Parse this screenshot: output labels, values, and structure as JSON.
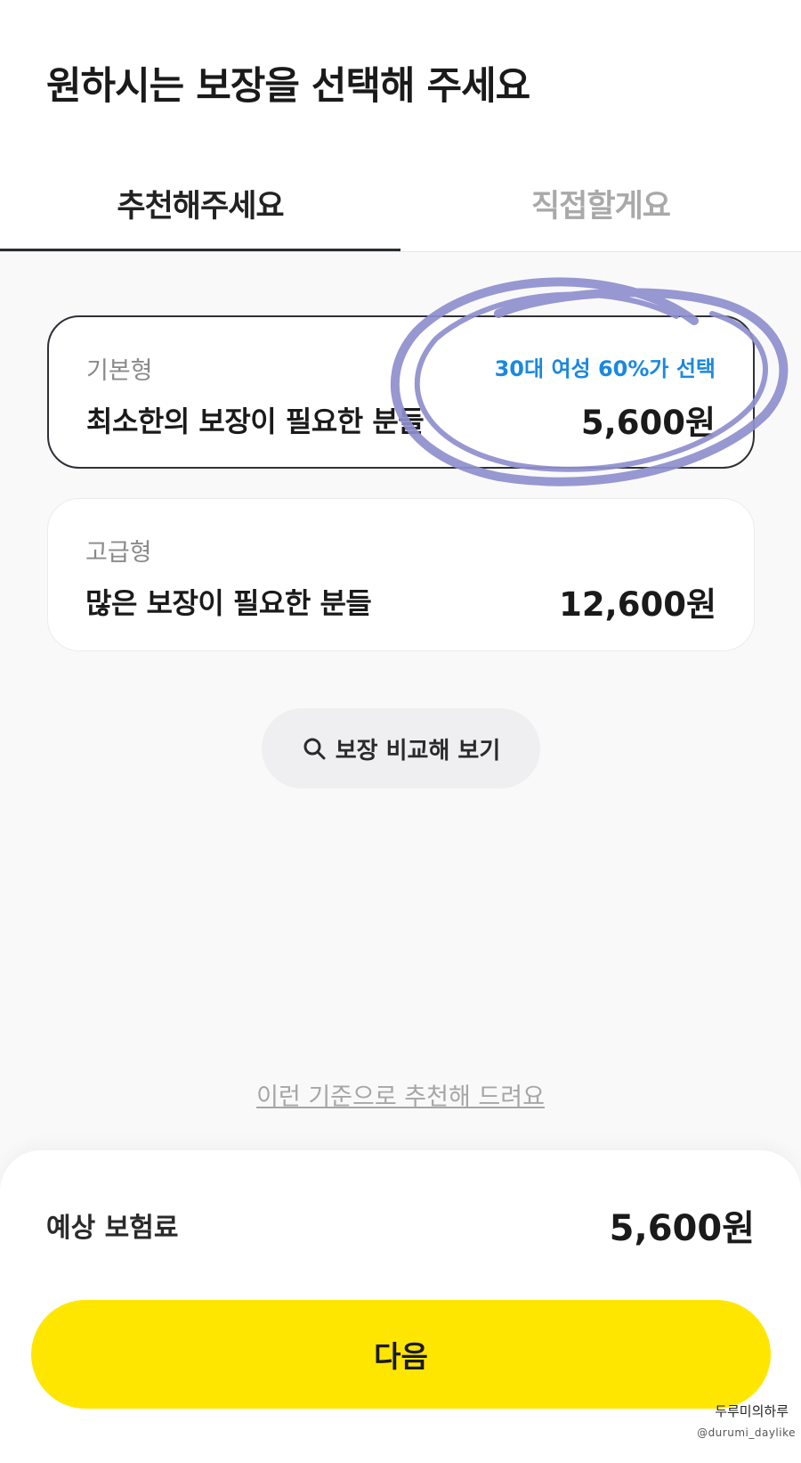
{
  "header": {
    "title": "원하시는 보장을 선택해 주세요"
  },
  "tabs": [
    {
      "label": "추천해주세요",
      "active": true
    },
    {
      "label": "직접할게요",
      "active": false
    }
  ],
  "plans": [
    {
      "type": "기본형",
      "badge": "30대 여성 60%가 선택",
      "description": "최소한의 보장이 필요한 분들",
      "price": "5,600원",
      "selected": true
    },
    {
      "type": "고급형",
      "description": "많은 보장이 필요한 분들",
      "price": "12,600원",
      "selected": false
    }
  ],
  "compare_button": {
    "label": "보장 비교해 보기",
    "icon": "search-icon"
  },
  "criteria_link": "이런 기준으로 추천해 드려요",
  "summary": {
    "label": "예상 보험료",
    "price": "5,600원",
    "next_button": "다음"
  },
  "watermark": {
    "name": "두루미의하루",
    "handle": "@durumi_daylike"
  },
  "colors": {
    "accent_yellow": "#ffe600",
    "badge_blue": "#1a88e0",
    "annotation_circle": "#8f8fcf"
  }
}
